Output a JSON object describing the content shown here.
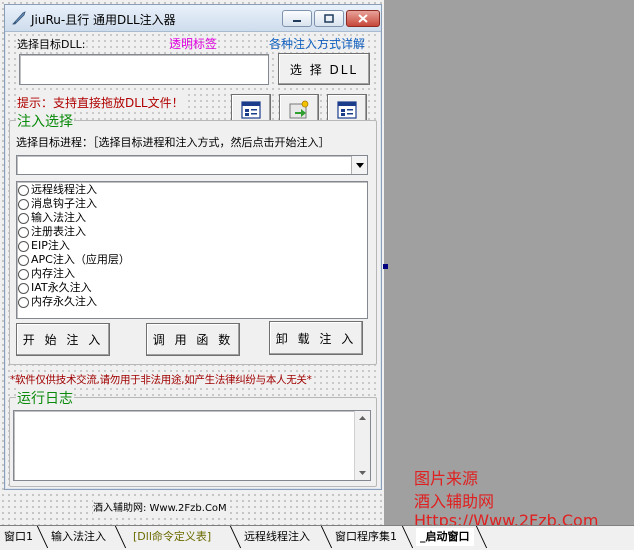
{
  "window": {
    "title": "JiuRu-且行 通用DLL注入器"
  },
  "dll": {
    "select_label": "选择目标DLL:",
    "transparent_label": "透明标签",
    "methods_link": "各种注入方式详解",
    "path_value": "",
    "select_button": "选 择 DLL",
    "tip": "提示：支持直接拖放DLL文件！"
  },
  "inject_group": {
    "title": "注入选择",
    "process_label": "选择目标进程：［选择目标进程和注入方式，然后点击开始注入］",
    "process_value": "",
    "methods": [
      "远程线程注入",
      "消息钩子注入",
      "输入法注入",
      "注册表注入",
      "EIP注入",
      "APC注入（应用层）",
      "内存注入",
      "IAT永久注入",
      "内存永久注入"
    ],
    "start_button": "开 始 注 入",
    "call_button": "调 用 函 数",
    "unload_button": "卸 载 注 入"
  },
  "disclaimer": "*软件仅供技术交流,请勿用于非法用途,如产生法律纠纷与本人无关*",
  "log_group": {
    "title": "运行日志",
    "content": ""
  },
  "footer_site": "酒入辅助网: Www.2Fzb.CoM",
  "watermark": {
    "line1": "图片来源",
    "line2": "酒入辅助网",
    "line3": "Https://Www.2Fzb.Com",
    "color": "#e02020"
  },
  "tabs": [
    "窗口1",
    "输入法注入",
    "[Dll命令定义表]",
    "远程线程注入",
    "窗口程序集1",
    "_启动窗口"
  ],
  "colors": {
    "magenta": "#e000e0",
    "blue_link": "#1060c0",
    "red_text": "#b00000",
    "green_title": "#0a8a0a",
    "dark_red": "#a00000",
    "tab_olive": "#6a6a00"
  }
}
